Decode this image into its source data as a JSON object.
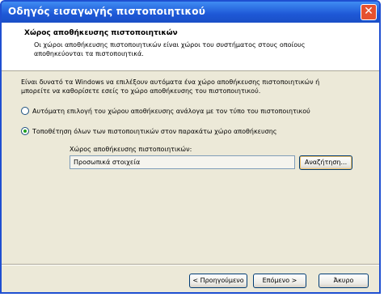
{
  "window": {
    "title": "Οδηγός εισαγωγής πιστοποιητικού",
    "close_label": "✕"
  },
  "header": {
    "title": "Χώρος αποθήκευσης πιστοποιητικών",
    "description": "Οι χώροι αποθήκευσης πιστοποιητικών είναι χώροι του συστήματος στους οποίους αποθηκεύονται τα πιστοποιητικά."
  },
  "body": {
    "intro": "Είναι δυνατό τα Windows να επιλέξουν αυτόματα ένα χώρο αποθήκευσης πιστοποιητικών ή μπορείτε να καθορίσετε εσείς το χώρο αποθήκευσης του πιστοποιητικού.",
    "option_auto": "Αυτόματη επιλογή του χώρου αποθήκευσης ανάλογα με τον τύπο του πιστοποιητικού",
    "option_manual": "Τοποθέτηση όλων των πιστοποιητικών στον παρακάτω χώρο αποθήκευσης",
    "selected_option": "manual",
    "store_label": "Χώρος αποθήκευσης πιστοποιητικών:",
    "store_value": "Προσωπικά στοιχεία",
    "browse_label": "Αναζήτηση..."
  },
  "footer": {
    "back_label": "< Προηγούμενο",
    "next_label": "Επόμενο >",
    "cancel_label": "Άκυρο"
  },
  "colors": {
    "title_bar": "#1e58d6",
    "close_button": "#e5512f",
    "dialog_background": "#ece9d8"
  }
}
